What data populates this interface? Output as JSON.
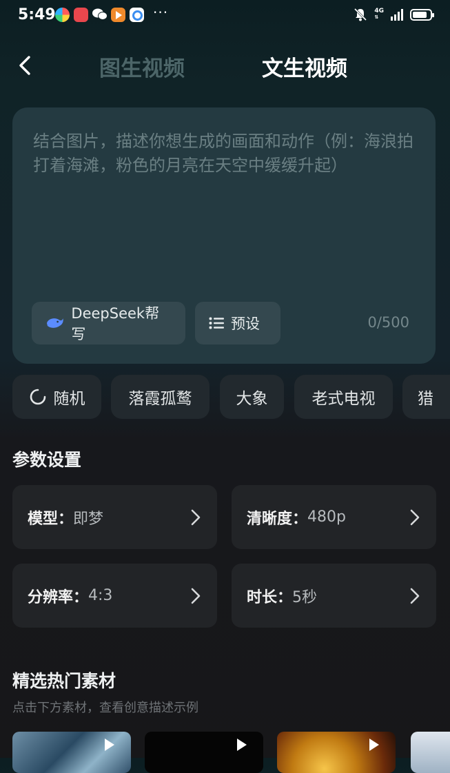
{
  "status_bar": {
    "time": "5:49",
    "network": "4G",
    "signal_bars": 4,
    "battery_level": 0.85,
    "app_icons": [
      {
        "icon": "colorful-pinwheel-icon",
        "color": "#2fb2ff"
      },
      {
        "icon": "huawei-store-icon",
        "color": "#e8474d"
      },
      {
        "icon": "wechat-icon",
        "color": "#dfe3e4"
      },
      {
        "icon": "video-play-icon",
        "color": "#f08a2b"
      },
      {
        "icon": "cloud-drive-icon",
        "color": "#3c8ef0"
      }
    ],
    "more": "···"
  },
  "header": {
    "tab_image_video": "图生视频",
    "tab_text_video": "文生视频",
    "active_tab": "文生视频"
  },
  "prompt": {
    "placeholder": "结合图片，描述你想生成的画面和动作（例：海浪拍打着海滩，粉色的月亮在天空中缓缓升起）",
    "deepseek_label": "DeepSeek帮写",
    "preset_label": "预设",
    "counter": "0/500"
  },
  "tags": [
    "随机",
    "落霞孤鹜",
    "大象",
    "老式电视",
    "猎"
  ],
  "params": {
    "title": "参数设置",
    "model_key": "模型：",
    "model_value": "即梦",
    "clarity_key": "清晰度：",
    "clarity_value": "480p",
    "ratio_key": "分辨率：",
    "ratio_value": "4:3",
    "duration_key": "时长：",
    "duration_value": "5秒"
  },
  "materials": {
    "title": "精选热门素材",
    "subtitle": "点击下方素材，查看创意描述示例"
  },
  "colors": {
    "accent": "#5b8cff",
    "card": "#243a41",
    "param_card": "#222427"
  }
}
